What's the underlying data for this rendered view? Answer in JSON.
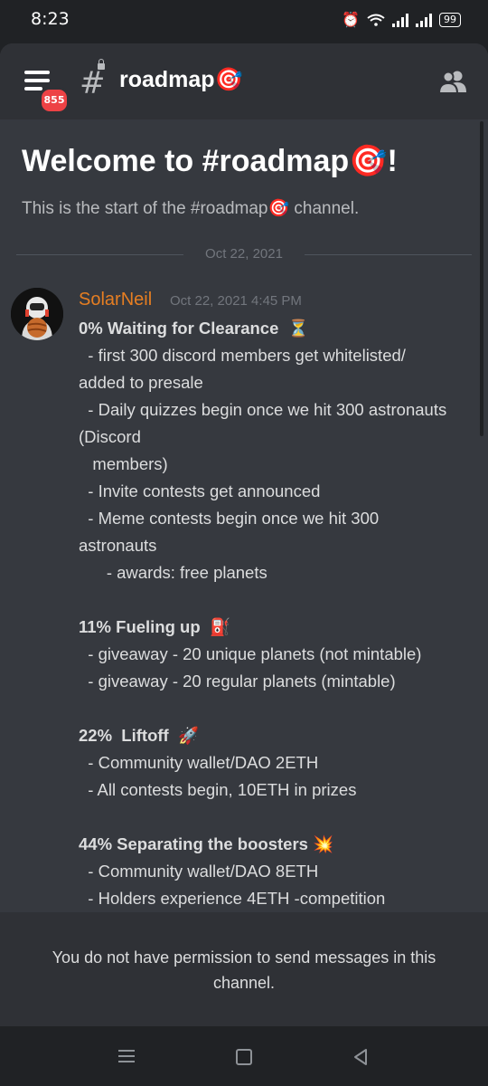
{
  "status_bar": {
    "time": "8:23",
    "battery": "99"
  },
  "header": {
    "badge": "855",
    "channel": "roadmap🎯"
  },
  "welcome": {
    "title": "Welcome to #roadmap🎯!",
    "subtitle": "This is the start of the #roadmap🎯 channel."
  },
  "divider_date": "Oct 22, 2021",
  "message": {
    "author": "SolarNeil",
    "timestamp": "Oct 22, 2021 4:45 PM",
    "author_color": "#e67e22",
    "lines": [
      {
        "text": "0% Waiting for Clearance  ⏳",
        "bold": true
      },
      {
        "text": "  - first 300 discord members get whitelisted/",
        "bold": false
      },
      {
        "text": "added to presale",
        "bold": false
      },
      {
        "text": "  - Daily quizzes begin once we hit 300 astronauts",
        "bold": false
      },
      {
        "text": "(Discord",
        "bold": false
      },
      {
        "text": "   members)",
        "bold": false
      },
      {
        "text": "  - Invite contests get announced",
        "bold": false
      },
      {
        "text": "  - Meme contests begin once we hit 300",
        "bold": false
      },
      {
        "text": "astronauts",
        "bold": false
      },
      {
        "text": "      - awards: free planets",
        "bold": false
      },
      {
        "text": "",
        "bold": false
      },
      {
        "text": "11% Fueling up  ⛽",
        "bold": true
      },
      {
        "text": "  - giveaway - 20 unique planets (not mintable)",
        "bold": false
      },
      {
        "text": "  - giveaway - 20 regular planets (mintable)",
        "bold": false
      },
      {
        "text": "",
        "bold": false
      },
      {
        "text": "22%  Liftoff  🚀",
        "bold": true
      },
      {
        "text": "  - Community wallet/DAO 2ETH",
        "bold": false
      },
      {
        "text": "  - All contests begin, 10ETH in prizes",
        "bold": false
      },
      {
        "text": "",
        "bold": false
      },
      {
        "text": "44% Separating the boosters 💥",
        "bold": true
      },
      {
        "text": "  - Community wallet/DAO 8ETH",
        "bold": false
      },
      {
        "text": "  - Holders experience 4ETH -competition",
        "bold": false
      }
    ]
  },
  "permission_notice": "You do not have permission to send messages in this channel.",
  "icons": [
    "hamburger-menu-icon",
    "locked-channel-hash-icon",
    "members-icon",
    "alarm-icon",
    "wifi-icon",
    "signal-icon",
    "battery-icon",
    "nav-recents-icon",
    "nav-home-icon",
    "nav-back-icon"
  ],
  "colors": {
    "background": "#36393f",
    "header": "#2f3136",
    "accent_red": "#ed4245"
  }
}
